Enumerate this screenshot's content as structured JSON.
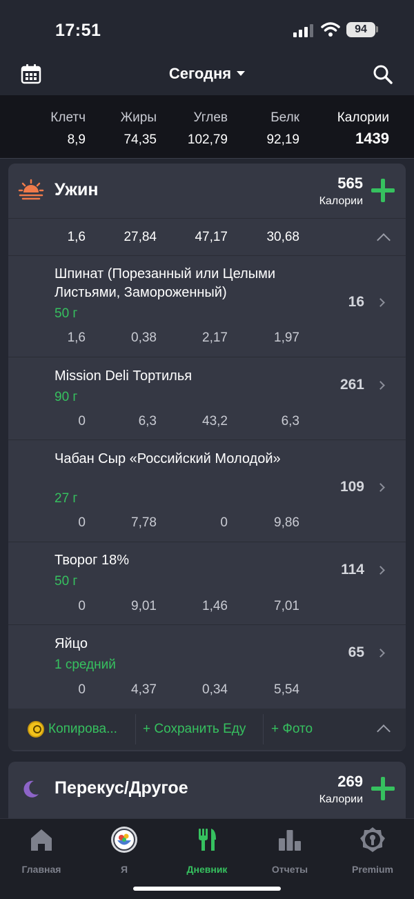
{
  "status_bar": {
    "time": "17:51",
    "battery": "94"
  },
  "header": {
    "title": "Сегодня"
  },
  "totals": {
    "columns": [
      {
        "label": "Клетч",
        "value": "8,9"
      },
      {
        "label": "Жиры",
        "value": "74,35"
      },
      {
        "label": "Углев",
        "value": "102,79"
      },
      {
        "label": "Белк",
        "value": "92,19"
      },
      {
        "label": "Калории",
        "value": "1439"
      }
    ]
  },
  "dinner": {
    "name": "Ужин",
    "calories": "565",
    "calories_unit": "Калории",
    "macros": [
      "1,6",
      "27,84",
      "47,17",
      "30,68"
    ],
    "foods": [
      {
        "name": "Шпинат (Порезанный или Целыми Листьями, Замороженный)",
        "qty": "50 г",
        "cal": "16",
        "macros": [
          "1,6",
          "0,38",
          "2,17",
          "1,97"
        ]
      },
      {
        "name": "Mission Deli Тортилья",
        "qty": "90 г",
        "cal": "261",
        "macros": [
          "0",
          "6,3",
          "43,2",
          "6,3"
        ]
      },
      {
        "name": "Чабан Сыр «Российский Молодой»",
        "qty": "27 г",
        "cal": "109",
        "macros": [
          "0",
          "7,78",
          "0",
          "9,86"
        ]
      },
      {
        "name": "Творог 18%",
        "qty": "50 г",
        "cal": "114",
        "macros": [
          "0",
          "9,01",
          "1,46",
          "7,01"
        ]
      },
      {
        "name": "Яйцо",
        "qty": "1 средний",
        "cal": "65",
        "macros": [
          "0",
          "4,37",
          "0,34",
          "5,54"
        ]
      }
    ],
    "footer": {
      "copy": "Копирова...",
      "save": "+ Сохранить Еду",
      "photo": "+ Фото"
    }
  },
  "snack": {
    "name": "Перекус/Другое",
    "calories": "269",
    "calories_unit": "Калории"
  },
  "tabs": [
    {
      "label": "Главная",
      "icon": "home-icon"
    },
    {
      "label": "Я",
      "icon": "avatar"
    },
    {
      "label": "Дневник",
      "icon": "fork-knife-icon"
    },
    {
      "label": "Отчеты",
      "icon": "bar-chart-icon"
    },
    {
      "label": "Premium",
      "icon": "premium-badge-icon"
    }
  ],
  "colors": {
    "accent": "#36c15f",
    "background": "#242731",
    "card": "#353844"
  }
}
